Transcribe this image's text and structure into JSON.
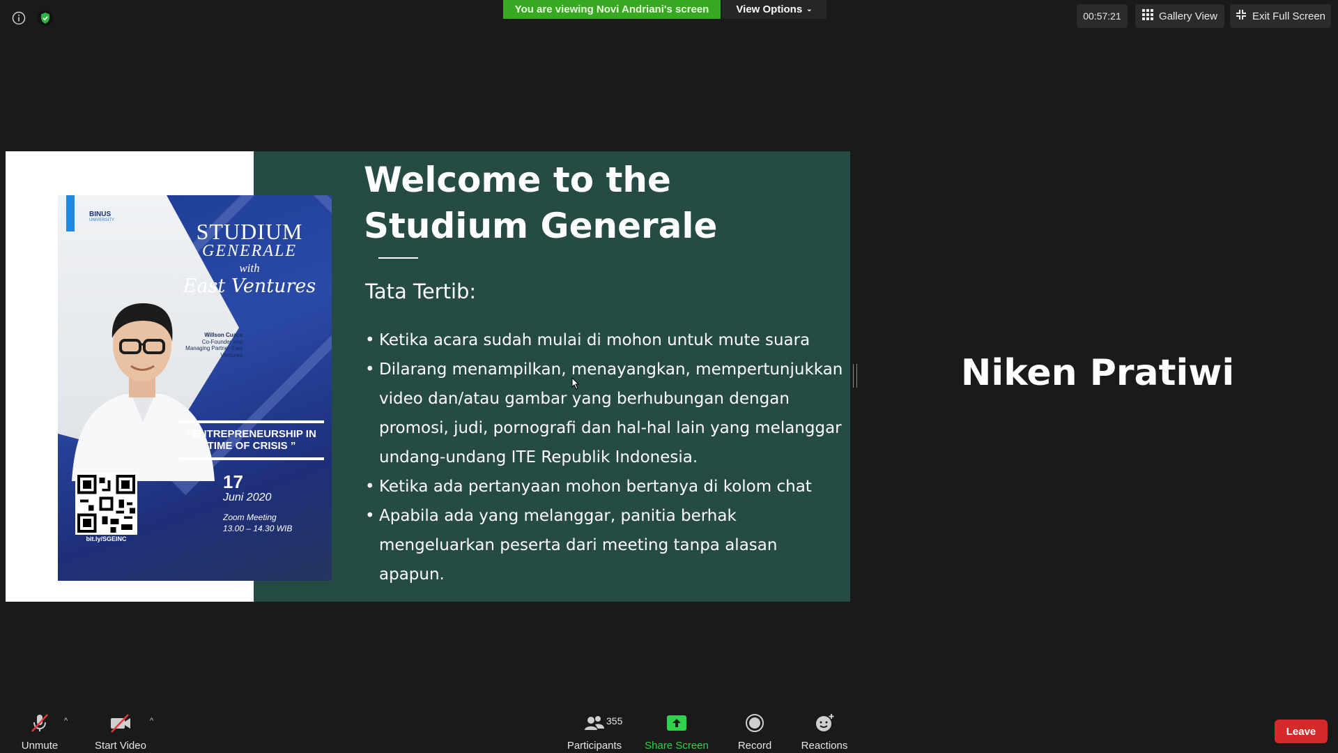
{
  "topbar": {
    "viewing_banner": "You are viewing Novi Andriani's screen",
    "view_options": "View Options",
    "timer": "00:57:21",
    "gallery_view": "Gallery View",
    "exit_full_screen": "Exit Full Screen"
  },
  "slide": {
    "title_line1": "Welcome to the",
    "title_line2": "Studium Generale",
    "subtitle": "Tata Tertib:",
    "rules": [
      "Ketika acara sudah mulai di mohon untuk mute suara",
      "Dilarang menampilkan, menayangkan, mempertunjukkan video dan/atau gambar yang berhubungan dengan promosi, judi, pornografi dan hal-hal lain yang melanggar undang-undang ITE Republik Indonesia.",
      "Ketika ada pertanyaan mohon bertanya di kolom chat",
      "Apabila ada yang melanggar, panitia berhak mengeluarkan peserta dari meeting tanpa alasan apapun."
    ],
    "poster": {
      "logo_text": "BINUS",
      "logo_sub": "UNIVERSITY",
      "title_1": "STUDIUM",
      "title_2": "GENERALE",
      "title_3": "with",
      "title_4": "East Ventures",
      "speaker_name": "Willson Cuaca",
      "speaker_role": "Co-Founder and Managing Partner East Ventures",
      "topic": "“ENTREPRENEURSHIP IN TIME OF CRISIS ”",
      "date_day": "17",
      "date_month": "Juni 2020",
      "meeting": "Zoom Meeting",
      "time": "13.00 – 14.30 WIB",
      "qr_url": "bit.ly/SGEINC"
    }
  },
  "participant_tile": {
    "name": "Niken Pratiwi"
  },
  "toolbar": {
    "unmute": "Unmute",
    "start_video": "Start Video",
    "participants": "Participants",
    "participant_count": "355",
    "share_screen": "Share Screen",
    "record": "Record",
    "reactions": "Reactions",
    "leave": "Leave"
  },
  "colors": {
    "banner_green": "#38a822",
    "share_green": "#2fd24a",
    "leave_red": "#d42a2a",
    "slide_teal": "#264a44"
  }
}
